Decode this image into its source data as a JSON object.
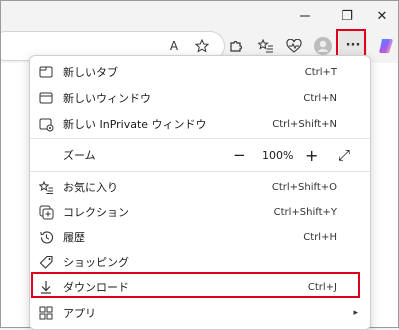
{
  "window": {
    "restore_glyph": "❐",
    "close_glyph": "✕"
  },
  "toolbar": {
    "read_aloud_glyph": "A",
    "more_glyph": "···"
  },
  "menu": {
    "items": [
      {
        "label": "新しいタブ",
        "shortcut": "Ctrl+T",
        "icon": "new-tab-icon"
      },
      {
        "label": "新しいウィンドウ",
        "shortcut": "Ctrl+N",
        "icon": "new-window-icon"
      },
      {
        "label": "新しい InPrivate ウィンドウ",
        "shortcut": "Ctrl+Shift+N",
        "icon": "inprivate-icon"
      },
      {
        "label": "お気に入り",
        "shortcut": "Ctrl+Shift+O",
        "icon": "favorites-icon"
      },
      {
        "label": "コレクション",
        "shortcut": "Ctrl+Shift+Y",
        "icon": "collections-icon"
      },
      {
        "label": "履歴",
        "shortcut": "Ctrl+H",
        "icon": "history-icon"
      },
      {
        "label": "ショッピング",
        "shortcut": "",
        "icon": "shopping-icon"
      },
      {
        "label": "ダウンロード",
        "shortcut": "Ctrl+J",
        "icon": "download-icon"
      },
      {
        "label": "アプリ",
        "shortcut": "",
        "icon": "apps-icon"
      }
    ],
    "zoom": {
      "label": "ズーム",
      "minus": "−",
      "value": "100%",
      "plus": "+",
      "fullscreen_glyph": "⤢"
    },
    "submenu_glyph": "▸"
  },
  "colors": {
    "highlight": "#e0001b"
  }
}
